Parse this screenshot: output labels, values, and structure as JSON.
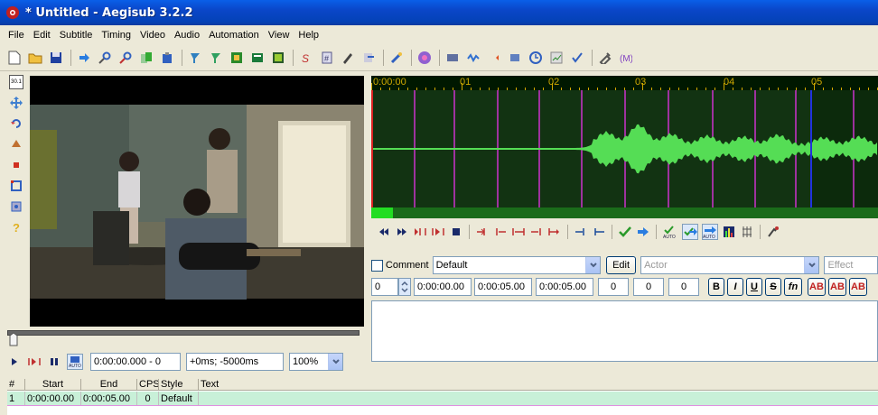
{
  "window": {
    "title": "* Untitled - Aegisub 3.2.2"
  },
  "menu": [
    "File",
    "Edit",
    "Subtitle",
    "Timing",
    "Video",
    "Audio",
    "Automation",
    "View",
    "Help"
  ],
  "toolbar_icons": [
    "new-file-icon",
    "open-folder-icon",
    "save-icon",
    "jump-icon",
    "find-icon",
    "replace-icon",
    "copy-icon",
    "paste-icon",
    "properties-icon",
    "attachments-icon",
    "fonts-icon",
    "styles-manager-icon",
    "translation-icon",
    "resample-icon",
    "spell-check-icon",
    "kanji-timer-icon",
    "shift-times-icon",
    "timing-postprocessor-icon",
    "automation-icon",
    "visual-typesetting-icon",
    "waveform-icon",
    "audio-icon",
    "video-icon",
    "stop-icon",
    "timer-icon",
    "styling-assistant-icon",
    "options-icon",
    "tools-icon"
  ],
  "video_tools": [
    "standard-tool-icon",
    "drag-tool-icon",
    "rotate-z-icon",
    "rotate-xy-icon",
    "scale-icon",
    "clip-icon",
    "vector-clip-icon",
    "help-icon"
  ],
  "video_panel": {
    "tool_label": "30.1",
    "time_display": "0:00:00.000 - 0",
    "offset_display": "+0ms; -5000ms",
    "zoom": "100%",
    "seek_position": 0
  },
  "waveform": {
    "ruler_labels": [
      "0:00:00",
      "01",
      "02",
      "03",
      "04",
      "05"
    ],
    "colors": {
      "background": "#0c2a0c",
      "wave": "#55dd55",
      "marker": "#cc33cc",
      "start": "#dd2222",
      "end": "#2233dd",
      "ruler": "#cfa800"
    }
  },
  "audio_controls": [
    "prev-line-icon",
    "next-line-icon",
    "play-before-icon",
    "play-after-icon",
    "stop-icon",
    "play-first-500-icon",
    "play-last-500-icon",
    "play-500-before-icon",
    "play-500-after-icon",
    "play-to-end-icon",
    "lead-in-icon",
    "lead-out-icon",
    "commit-icon",
    "goto-icon",
    "auto-commit-icon",
    "auto-next-icon",
    "auto-scroll-icon",
    "spectrum-icon",
    "karaoke-icon",
    "timing-icon"
  ],
  "edit": {
    "comment_label": "Comment",
    "style": "Default",
    "edit_button": "Edit",
    "actor_placeholder": "Actor",
    "effect_placeholder": "Effect",
    "layer": "0",
    "start": "0:00:00.00",
    "end": "0:00:05.00",
    "duration": "0:00:05.00",
    "margin_l": "0",
    "margin_r": "0",
    "margin_v": "0",
    "format_buttons": [
      "B",
      "I",
      "U",
      "S",
      "fn",
      "AB",
      "AB",
      "AB"
    ]
  },
  "grid": {
    "headers": [
      "#",
      "Start",
      "End",
      "CPS",
      "Style",
      "Text"
    ],
    "rows": [
      {
        "n": "1",
        "start": "0:00:00.00",
        "end": "0:00:05.00",
        "cps": "0",
        "style": "Default",
        "text": ""
      }
    ]
  }
}
